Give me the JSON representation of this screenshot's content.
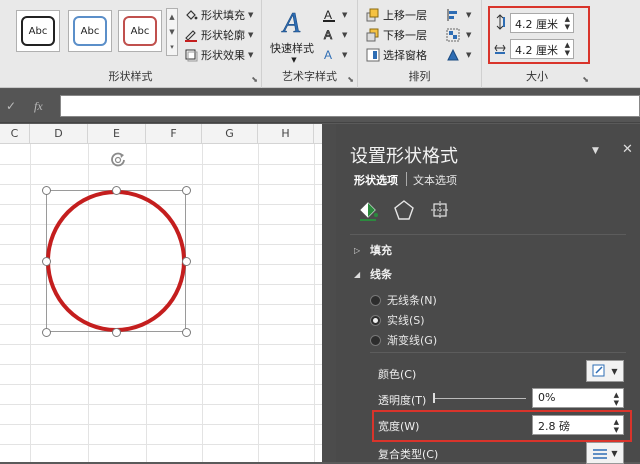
{
  "ribbon": {
    "shape_styles": {
      "swatches": [
        {
          "label": "Abc",
          "border": "#222222"
        },
        {
          "label": "Abc",
          "border": "#5b8fc9"
        },
        {
          "label": "Abc",
          "border": "#c0504d"
        }
      ],
      "fill_label": "形状填充",
      "outline_label": "形状轮廓",
      "effects_label": "形状效果",
      "group_label": "形状样式"
    },
    "wordart": {
      "quick_styles_label": "快速样式",
      "group_label": "艺术字样式"
    },
    "arrange": {
      "bring_forward_label": "上移一层",
      "send_backward_label": "下移一层",
      "selection_pane_label": "选择窗格",
      "group_label": "排列"
    },
    "size": {
      "height_value": "4.2 厘米",
      "width_value": "4.2 厘米",
      "group_label": "大小"
    }
  },
  "formula_bar": {
    "fx_label": "fx"
  },
  "sheet": {
    "columns": [
      "C",
      "D",
      "E",
      "F",
      "G",
      "H"
    ]
  },
  "pane": {
    "title": "设置形状格式",
    "tabs": {
      "shape_options": "形状选项",
      "text_options": "文本选项"
    },
    "sections": {
      "fill": "填充",
      "line": "线条"
    },
    "line_options": {
      "no_line": "无线条(N)",
      "solid_line": "实线(S)",
      "gradient_line": "渐变线(G)"
    },
    "props": {
      "color_label": "颜色(C)",
      "transparency_label": "透明度(T)",
      "transparency_value": "0%",
      "width_label": "宽度(W)",
      "width_value": "2.8 磅",
      "compound_label": "复合类型(C)"
    }
  },
  "colors": {
    "accent_red": "#c41e1e",
    "highlight_box": "#d9342b",
    "pane_bg": "#4a4a4a",
    "ribbon_bg": "#e9e9e9"
  }
}
